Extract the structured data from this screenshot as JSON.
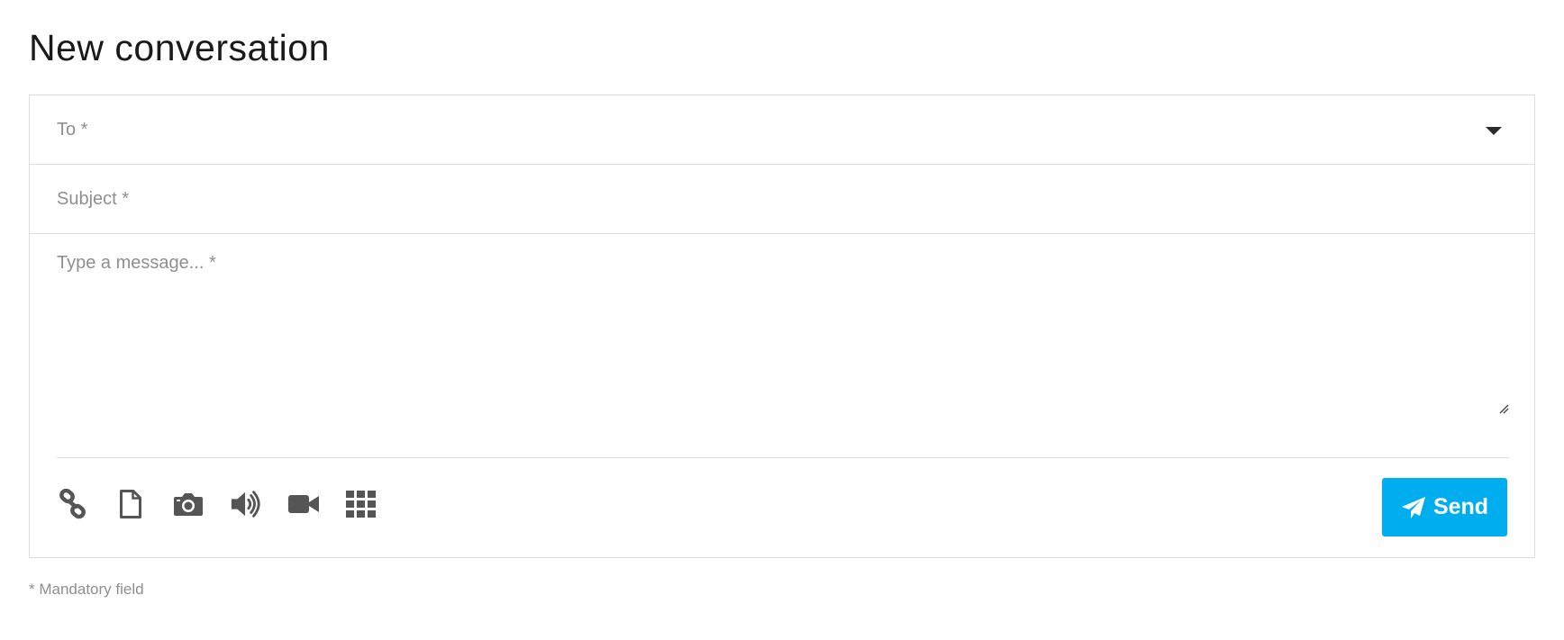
{
  "page": {
    "title": "New conversation"
  },
  "form": {
    "to": {
      "label": "To *"
    },
    "subject": {
      "placeholder": "Subject *",
      "value": ""
    },
    "message": {
      "placeholder": "Type a message... *",
      "value": ""
    }
  },
  "toolbar": {
    "icons": [
      "link-icon",
      "file-icon",
      "camera-icon",
      "audio-icon",
      "video-icon",
      "grid-icon"
    ],
    "send_label": "Send"
  },
  "colors": {
    "accent": "#00aeef",
    "icon": "#555555",
    "border": "#dedede",
    "placeholder": "#8f8f8f"
  },
  "footnote": "* Mandatory field"
}
